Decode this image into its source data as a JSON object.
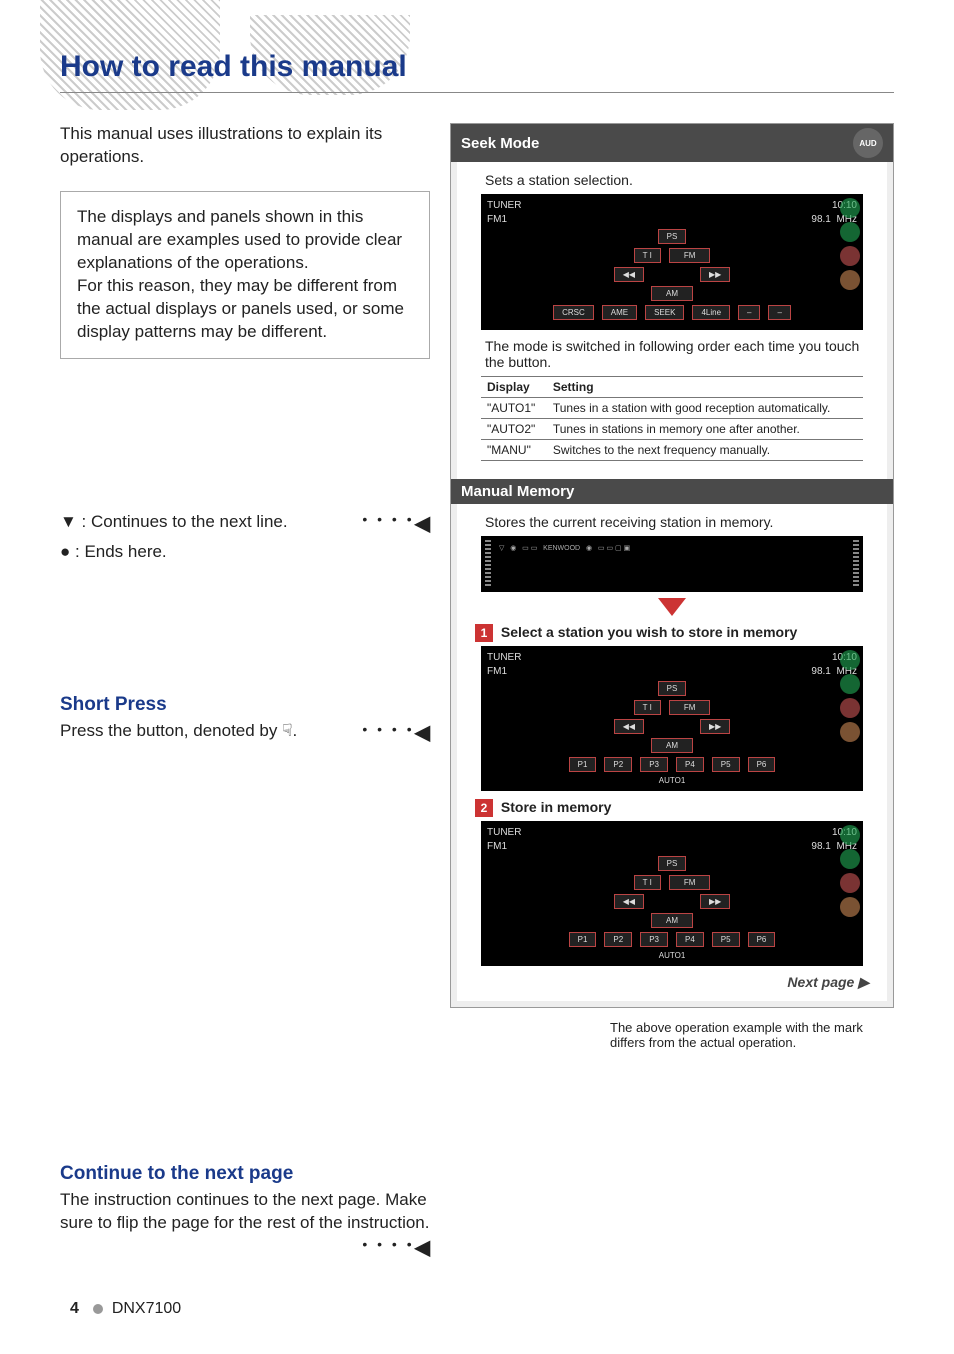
{
  "header": {
    "title": "How to read this manual"
  },
  "intro": "This manual uses illustrations to explain its operations.",
  "notebox": "The displays and panels shown in this manual are examples used to provide clear explanations of the operations.\nFor this reason, they may be different from the actual displays or panels used, or some display patterns may be different.",
  "legend": {
    "continues_prefix": "▼ : ",
    "continues": "Continues to the next line.",
    "ends_prefix": "● : ",
    "ends": "Ends here."
  },
  "short_press": {
    "heading": "Short Press",
    "body_before": "Press the button, denoted by ",
    "body_after": "."
  },
  "continue_block": {
    "heading": "Continue to the next page",
    "body": "The instruction continues to the next page. Make sure to flip the page for the rest of the instruction."
  },
  "seek": {
    "heading": "Seek Mode",
    "aud_label": "AUD",
    "sub": "Sets a station selection.",
    "screen": {
      "title": "TUNER",
      "band": "FM1",
      "freq": "98.1",
      "unit": "MHz",
      "time": "10:10",
      "ps": "PS",
      "ti": "T I",
      "fm": "FM",
      "am": "AM",
      "prev": "◀◀",
      "next": "▶▶",
      "btns": [
        "CRSC",
        "AME",
        "SEEK",
        "4Line",
        "–",
        "–"
      ]
    },
    "after_screen": "The mode is switched in following order each time you touch the button.",
    "table": {
      "headers": [
        "Display",
        "Setting"
      ],
      "rows": [
        [
          "\"AUTO1\"",
          "Tunes in a station with good reception automatically."
        ],
        [
          "\"AUTO2\"",
          "Tunes in stations in memory one after another."
        ],
        [
          "\"MANU\"",
          "Switches to the next frequency manually."
        ]
      ]
    }
  },
  "manual_memory": {
    "heading": "Manual Memory",
    "sub": "Stores the current receiving station in memory.",
    "step1": {
      "num": "1",
      "text": "Select a station you wish to store in memory"
    },
    "screen1": {
      "title": "TUNER",
      "band": "FM1",
      "freq": "98.1",
      "unit": "MHz",
      "time": "10:10",
      "ps": "PS",
      "ti": "T I",
      "fm": "FM",
      "am": "AM",
      "auto": "AUTO1",
      "presets": [
        "P1",
        "P2",
        "P3",
        "P4",
        "P5",
        "P6"
      ]
    },
    "step2": {
      "num": "2",
      "text": "Store in memory"
    },
    "screen2": {
      "title": "TUNER",
      "band": "FM1",
      "freq": "98.1",
      "unit": "MHz",
      "time": "10:10",
      "ps": "PS",
      "ti": "T I",
      "fm": "FM",
      "am": "AM",
      "auto": "AUTO1",
      "presets": [
        "P1",
        "P2",
        "P3",
        "P4",
        "P5",
        "P6"
      ]
    },
    "next_page": "Next page ▶"
  },
  "caption": "The above operation example with the mark differs from the actual operation.",
  "footer": {
    "page": "4",
    "model": "DNX7100"
  }
}
